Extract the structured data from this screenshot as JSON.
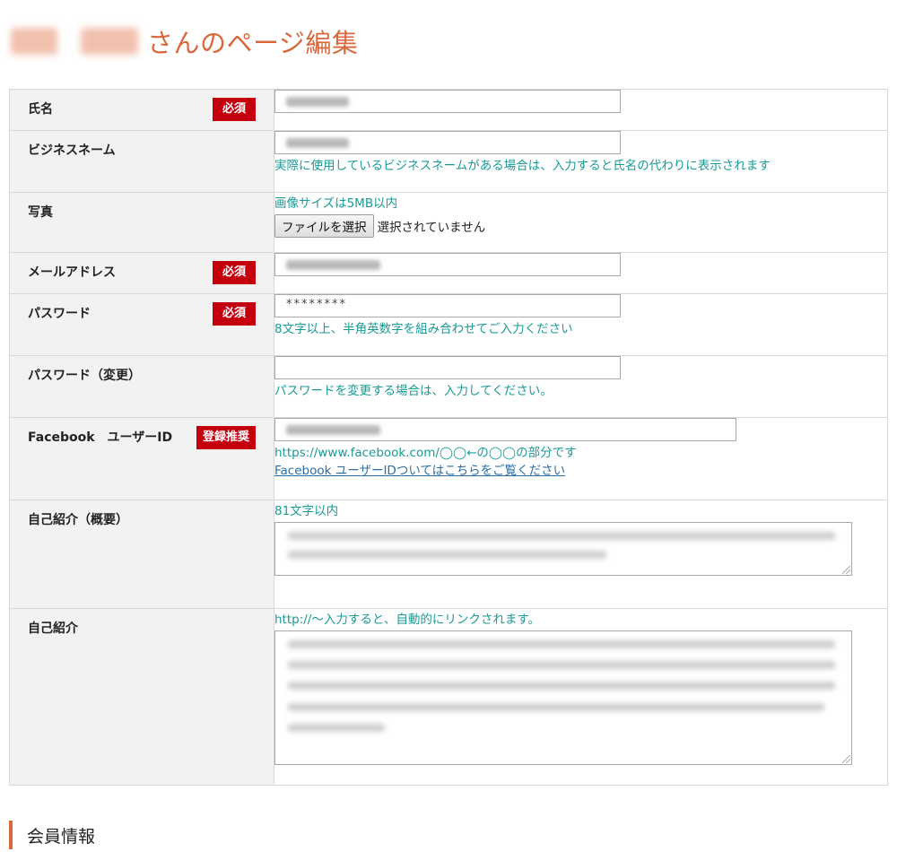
{
  "page_title_suffix": "さんのページ編集",
  "badges": {
    "required": "必須",
    "recommended": "登録推奨"
  },
  "fields": {
    "name": {
      "label": "氏名"
    },
    "business_name": {
      "label": "ビジネスネーム",
      "hint": "実際に使用しているビジネスネームがある場合は、入力すると氏名の代わりに表示されます"
    },
    "photo": {
      "label": "写真",
      "hint": "画像サイズは5MB以内",
      "button_label": "ファイルを選択",
      "file_status": "選択されていません"
    },
    "email": {
      "label": "メールアドレス"
    },
    "password": {
      "label": "パスワード",
      "value": "********",
      "hint": "8文字以上、半角英数字を組み合わせてご入力ください"
    },
    "password_change": {
      "label": "パスワード（変更）",
      "value": "",
      "hint": "パスワードを変更する場合は、入力してください。"
    },
    "facebook": {
      "label": "Facebook　ユーザーID",
      "hint": "https://www.facebook.com/◯◯←の◯◯の部分です",
      "link": "Facebook ユーザーIDついてはこちらをご覧ください"
    },
    "intro_summary": {
      "label": "自己紹介（概要）",
      "hint": "81文字以内"
    },
    "intro": {
      "label": "自己紹介",
      "hint": "http://～入力すると、自動的にリンクされます。"
    }
  },
  "section_heading": "会員情報",
  "colors": {
    "title": "#d9683c",
    "badge": "#c4000f",
    "hint": "#1a9a94",
    "link": "#2a6ea3",
    "label_bg": "#f2f2f2"
  }
}
